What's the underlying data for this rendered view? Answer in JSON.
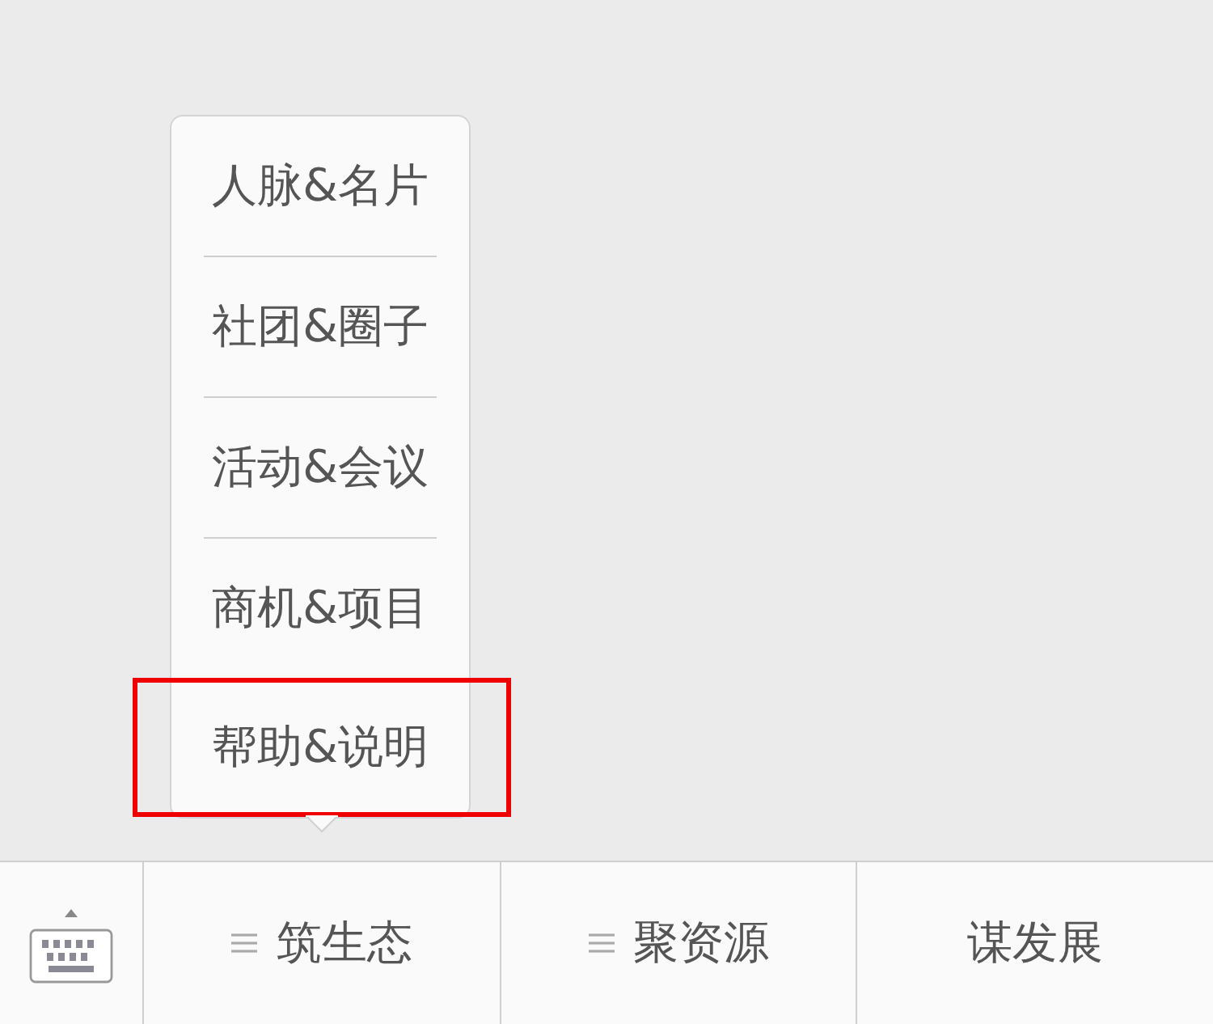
{
  "menu": [
    {
      "label": "人脉&名片",
      "highlighted": false
    },
    {
      "label": "社团&圈子",
      "highlighted": false
    },
    {
      "label": "活动&会议",
      "highlighted": false
    },
    {
      "label": "商机&项目",
      "highlighted": false
    },
    {
      "label": "帮助&说明",
      "highlighted": true
    }
  ],
  "tabs": [
    {
      "label": "筑生态",
      "has_submenu": true
    },
    {
      "label": "聚资源",
      "has_submenu": true
    },
    {
      "label": "谋发展",
      "has_submenu": false
    }
  ]
}
